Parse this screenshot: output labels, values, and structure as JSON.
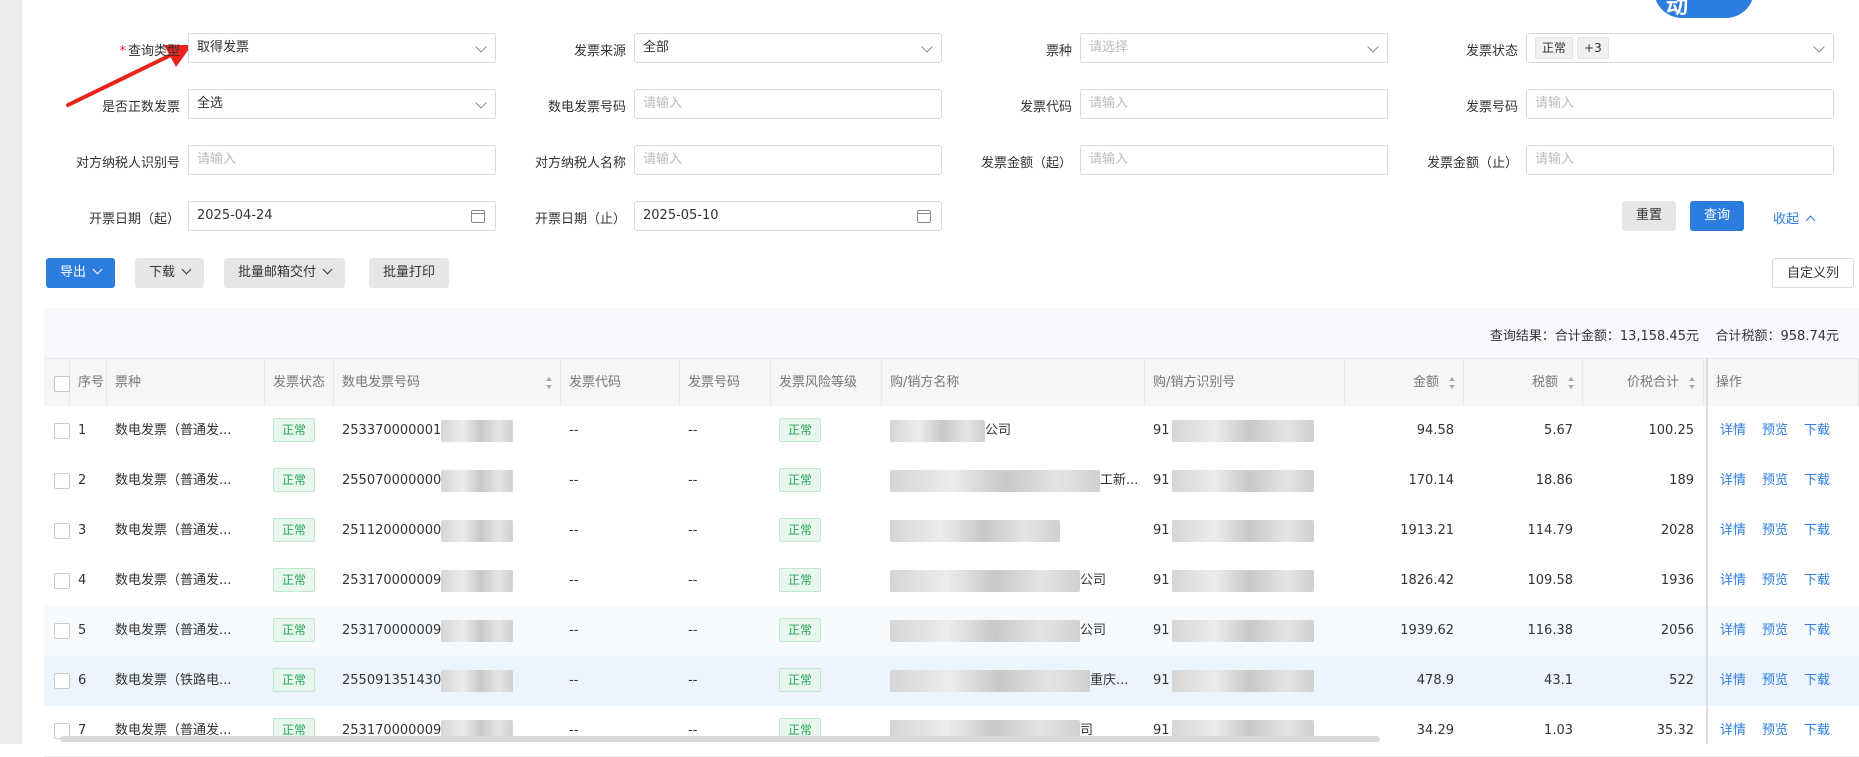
{
  "logo": {
    "text": "动"
  },
  "filters": {
    "row1": [
      {
        "label": "查询类型",
        "required": true,
        "value": "取得发票",
        "placeholder": "",
        "kind": "select"
      },
      {
        "label": "发票来源",
        "required": false,
        "value": "全部",
        "placeholder": "",
        "kind": "select"
      },
      {
        "label": "票种",
        "required": false,
        "value": "",
        "placeholder": "请选择",
        "kind": "select"
      },
      {
        "label": "发票状态",
        "required": false,
        "value": "",
        "placeholder": "",
        "kind": "tags",
        "tags": [
          "正常",
          "+3"
        ]
      }
    ],
    "row2": [
      {
        "label": "是否正数发票",
        "value": "全选",
        "placeholder": "",
        "kind": "select"
      },
      {
        "label": "数电发票号码",
        "value": "",
        "placeholder": "请输入",
        "kind": "input"
      },
      {
        "label": "发票代码",
        "value": "",
        "placeholder": "请输入",
        "kind": "input"
      },
      {
        "label": "发票号码",
        "value": "",
        "placeholder": "请输入",
        "kind": "input"
      }
    ],
    "row3": [
      {
        "label": "对方纳税人识别号",
        "value": "",
        "placeholder": "请输入",
        "kind": "input"
      },
      {
        "label": "对方纳税人名称",
        "value": "",
        "placeholder": "请输入",
        "kind": "input"
      },
      {
        "label": "发票金额（起）",
        "value": "",
        "placeholder": "请输入",
        "kind": "input"
      },
      {
        "label": "发票金额（止）",
        "value": "",
        "placeholder": "请输入",
        "kind": "input"
      }
    ],
    "row4": [
      {
        "label": "开票日期（起）",
        "value": "2025-04-24",
        "kind": "date"
      },
      {
        "label": "开票日期（止）",
        "value": "2025-05-10",
        "kind": "date"
      }
    ],
    "reset_label": "重置",
    "query_label": "查询",
    "collapse_label": "收起"
  },
  "toolbar": {
    "export_label": "导出",
    "download_label": "下载",
    "batch_email_label": "批量邮箱交付",
    "batch_print_label": "批量打印",
    "custom_columns_label": "自定义列"
  },
  "summary": {
    "text": "查询结果：合计金额：13,158.45元    合计税额：958.74元"
  },
  "table": {
    "columns": [
      "序号",
      "票种",
      "发票状态",
      "数电发票号码",
      "发票代码",
      "发票号码",
      "发票风险等级",
      "购/销方名称",
      "购/销方识别号",
      "金额",
      "税额",
      "价税合计",
      "操作"
    ],
    "rows": [
      {
        "no": "1",
        "type": "数电发票（普通发...",
        "status": "正常",
        "number": "253370000001",
        "code": "--",
        "fpno": "--",
        "risk": "正常",
        "name_suffix": "公司",
        "tax_id": "91",
        "amount": "94.58",
        "tax": "5.67",
        "total": "100.25"
      },
      {
        "no": "2",
        "type": "数电发票（普通发...",
        "status": "正常",
        "number": "255070000000",
        "code": "--",
        "fpno": "--",
        "risk": "正常",
        "name_suffix": "工新...",
        "tax_id": "91",
        "amount": "170.14",
        "tax": "18.86",
        "total": "189"
      },
      {
        "no": "3",
        "type": "数电发票（普通发...",
        "status": "正常",
        "number": "251120000000",
        "code": "--",
        "fpno": "--",
        "risk": "正常",
        "name_suffix": "",
        "tax_id": "91",
        "amount": "1913.21",
        "tax": "114.79",
        "total": "2028"
      },
      {
        "no": "4",
        "type": "数电发票（普通发...",
        "status": "正常",
        "number": "253170000009",
        "code": "--",
        "fpno": "--",
        "risk": "正常",
        "name_suffix": "公司",
        "tax_id": "91",
        "amount": "1826.42",
        "tax": "109.58",
        "total": "1936"
      },
      {
        "no": "5",
        "type": "数电发票（普通发...",
        "status": "正常",
        "number": "253170000009",
        "code": "--",
        "fpno": "--",
        "risk": "正常",
        "name_suffix": "公司",
        "tax_id": "91",
        "amount": "1939.62",
        "tax": "116.38",
        "total": "2056"
      },
      {
        "no": "6",
        "type": "数电发票（铁路电...",
        "status": "正常",
        "number": "255091351430",
        "code": "--",
        "fpno": "--",
        "risk": "正常",
        "name_suffix": "重庆...",
        "tax_id": "91",
        "amount": "478.9",
        "tax": "43.1",
        "total": "522"
      },
      {
        "no": "7",
        "type": "数电发票（普通发...",
        "status": "正常",
        "number": "253170000009",
        "code": "--",
        "fpno": "--",
        "risk": "正常",
        "name_suffix": "司",
        "tax_id": "91",
        "amount": "34.29",
        "tax": "1.03",
        "total": "35.32"
      }
    ],
    "actions": [
      "详情",
      "预览",
      "下载"
    ]
  },
  "colors": {
    "primary": "#2d7de0",
    "status_green": "#27a55a",
    "arrow_red": "#e8231e"
  }
}
